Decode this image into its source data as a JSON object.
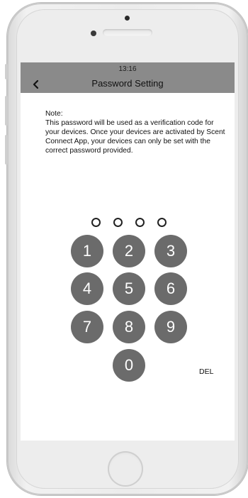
{
  "status_bar": {
    "time": "13:16"
  },
  "header": {
    "title": "Password Setting"
  },
  "note": {
    "title": "Note:",
    "body": "This password will be used as a verification code for your devices. Once your devices are activated by Scent Connect App, your devices can only be set with the correct password provided."
  },
  "password": {
    "length": 4,
    "entered": 0
  },
  "keypad": {
    "keys": [
      "1",
      "2",
      "3",
      "4",
      "5",
      "6",
      "7",
      "8",
      "9",
      "0"
    ],
    "delete_label": "DEL"
  },
  "colors": {
    "header_bg": "#8a8a8a",
    "key_bg": "#6b6b6b",
    "key_text": "#ffffff"
  }
}
